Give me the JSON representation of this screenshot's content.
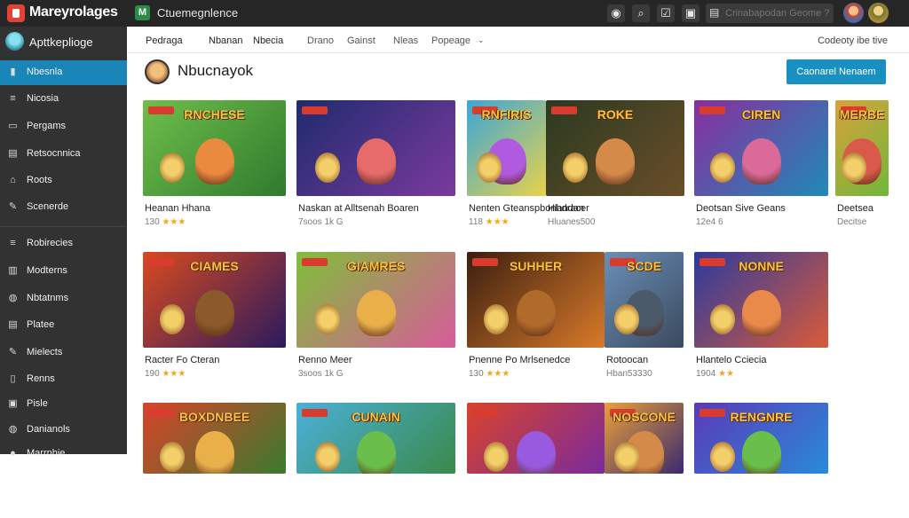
{
  "topbar": {
    "logo_text": "Mareyrolages",
    "app_badge": "M",
    "app_title": "Ctuemegnlence",
    "search_placeholder": "Crinabapodan Geome ?",
    "icons": [
      "record-icon",
      "search-icon",
      "checklist-icon",
      "image-icon",
      "chat-icon",
      "help-icon"
    ]
  },
  "sidebar": {
    "title": "Apttkeplioge",
    "items": [
      {
        "label": "Nbesnla",
        "icon": "page-icon",
        "active": true
      },
      {
        "label": "Nicosia",
        "icon": "list-icon"
      },
      {
        "label": "Pergams",
        "icon": "bookmark-icon"
      },
      {
        "label": "Retsocnnica",
        "icon": "file-icon"
      },
      {
        "label": "Roots",
        "icon": "tree-icon"
      },
      {
        "label": "Scenerde",
        "icon": "pencil-icon"
      },
      {
        "label": "Robirecies",
        "icon": "list-icon"
      },
      {
        "label": "Modterns",
        "icon": "folder-icon"
      },
      {
        "label": "Nbtatnms",
        "icon": "globe-icon"
      },
      {
        "label": "Platee",
        "icon": "document-icon"
      },
      {
        "label": "Mielects",
        "icon": "pencil-icon"
      },
      {
        "label": "Renns",
        "icon": "book-icon"
      },
      {
        "label": "Pisle",
        "icon": "image-icon"
      },
      {
        "label": "Danianols",
        "icon": "globe-icon"
      },
      {
        "label": "Marrnhie",
        "icon": "user-icon"
      }
    ]
  },
  "tabs": {
    "items": [
      "Pedraga",
      "Nbanan",
      "Nbecia",
      "Drano",
      "Gainst",
      "Nleas",
      "Popeage"
    ],
    "right": "Codeoty ibe tive"
  },
  "user": {
    "name": "Nbucnayok"
  },
  "cta": {
    "label": "Caonarel Nenaem"
  },
  "cards": [
    {
      "title": "Heanan Hhana",
      "rating": "130",
      "stars": 3,
      "meta": "",
      "thumb_text": "RNCHESE",
      "bg": [
        "#6fbf4a",
        "#2f7a2e"
      ],
      "hero": "#e98a3f"
    },
    {
      "title": "Naskan at Alltsenah Boaren",
      "rating": "7soos",
      "stars": 0,
      "meta": "1k  G",
      "thumb_text": "",
      "bg": [
        "#1f2b6e",
        "#7a3a9e"
      ],
      "hero": "#e86b6b"
    },
    {
      "title": "Nenten Gteanspbonhdracer",
      "rating": "118",
      "stars": 3,
      "meta": "",
      "thumb_text": "RNFIRIS",
      "bg": [
        "#3aa6d9",
        "#e9d24a"
      ],
      "hero": "#b05ae0"
    },
    {
      "title": "Hlandan",
      "rating": "",
      "stars": 0,
      "meta": "Hluanes500",
      "thumb_text": "ROKE",
      "bg": [
        "#2b3a1f",
        "#6a4e2a"
      ],
      "hero": "#d48b4a"
    },
    {
      "title": "Deotsan Sive Geans",
      "rating": "12e4",
      "stars": 0,
      "meta": "6",
      "thumb_text": "CIREN",
      "bg": [
        "#8a2d9e",
        "#1f8ab8"
      ],
      "hero": "#d96a9a"
    },
    {
      "title": "Deetsea",
      "rating": "",
      "stars": 0,
      "meta": "Decitse",
      "thumb_text": "MERBE",
      "bg": [
        "#d9a23a",
        "#6fb83a"
      ],
      "hero": "#d95a4a"
    },
    {
      "title": "Racter Fo Cteran",
      "rating": "190",
      "stars": 3,
      "meta": "",
      "thumb_text": "CIAMES",
      "bg": [
        "#d94a1f",
        "#2b1a5e"
      ],
      "hero": "#8a5a2a"
    },
    {
      "title": "Renno Meer",
      "rating": "3soos",
      "stars": 0,
      "meta": "1k  G",
      "thumb_text": "GIAMRES",
      "bg": [
        "#7fbf3a",
        "#d95a9a"
      ],
      "hero": "#e9b04a"
    },
    {
      "title": "Pnenne Po Mrlsenedce",
      "rating": "130",
      "stars": 3,
      "meta": "",
      "thumb_text": "SUHHER",
      "bg": [
        "#3a1f0f",
        "#d97a2a"
      ],
      "hero": "#b06a2a"
    },
    {
      "title": "Rotoocan",
      "rating": "",
      "stars": 0,
      "meta": "Hban53330",
      "thumb_text": "SCDE",
      "bg": [
        "#6a8fb8",
        "#3a4a5e"
      ],
      "hero": "#4a5a6a"
    },
    {
      "title": "Hlantelo Cciecia",
      "rating": "1904",
      "stars": 2,
      "meta": "",
      "thumb_text": "NONNE",
      "bg": [
        "#2b3a9e",
        "#d95a3a"
      ],
      "hero": "#e98a4a"
    },
    {
      "title": "",
      "rating": "",
      "stars": 0,
      "meta": "",
      "thumb_text": "BOXDNBEE",
      "bg": [
        "#d9432a",
        "#3a7a2e"
      ],
      "hero": "#e9b04a"
    },
    {
      "title": "",
      "rating": "",
      "stars": 0,
      "meta": "",
      "thumb_text": "CUNAIN",
      "bg": [
        "#4ab0d9",
        "#3a8a4a"
      ],
      "hero": "#6abf4a"
    },
    {
      "title": "",
      "rating": "",
      "stars": 0,
      "meta": "",
      "thumb_text": "",
      "bg": [
        "#d9432a",
        "#7a2a9e"
      ],
      "hero": "#9a5ae0"
    },
    {
      "title": "",
      "rating": "",
      "stars": 0,
      "meta": "",
      "thumb_text": "NOSCONE",
      "bg": [
        "#e9a03a",
        "#3a2a6e"
      ],
      "hero": "#d48b4a"
    },
    {
      "title": "",
      "rating": "",
      "stars": 0,
      "meta": "",
      "thumb_text": "RENGNRE",
      "bg": [
        "#5a3ab8",
        "#2a8ad9"
      ],
      "hero": "#6abf4a"
    }
  ],
  "colors": {
    "accent": "#1890c2",
    "sidebar_bg": "#323232",
    "topbar_bg": "#262626",
    "badge": "#d93b2f"
  }
}
